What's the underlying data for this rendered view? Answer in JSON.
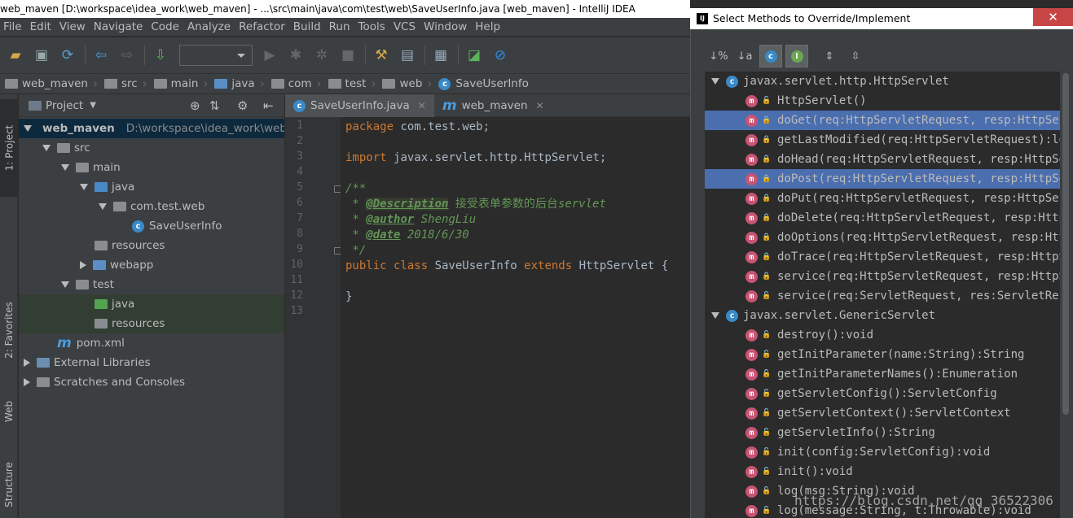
{
  "window": {
    "title": "web_maven [D:\\workspace\\idea_work\\web_maven] - ...\\src\\main\\java\\com\\test\\web\\SaveUserInfo.java [web_maven] - IntelliJ IDEA"
  },
  "menu": [
    "File",
    "Edit",
    "View",
    "Navigate",
    "Code",
    "Analyze",
    "Refactor",
    "Build",
    "Run",
    "Tools",
    "VCS",
    "Window",
    "Help"
  ],
  "breadcrumb": [
    "web_maven",
    "src",
    "main",
    "java",
    "com",
    "test",
    "web",
    "SaveUserInfo"
  ],
  "side_tabs": {
    "project": "1: Project",
    "favorites": "2: Favorites",
    "web": "Web",
    "structure": "Structure"
  },
  "project_panel": {
    "title": "Project",
    "tree": [
      {
        "label": "web_maven",
        "path": "D:\\workspace\\idea_work\\web_maven",
        "depth": 0,
        "arrow": "down",
        "icon": "module-folder-icon",
        "selected": true
      },
      {
        "label": "src",
        "depth": 1,
        "arrow": "down",
        "icon": "folder-icon"
      },
      {
        "label": "main",
        "depth": 2,
        "arrow": "down",
        "icon": "folder-icon"
      },
      {
        "label": "java",
        "depth": 3,
        "arrow": "down",
        "icon": "source-folder-icon"
      },
      {
        "label": "com.test.web",
        "depth": 4,
        "arrow": "down",
        "icon": "package-icon"
      },
      {
        "label": "SaveUserInfo",
        "depth": 5,
        "arrow": "",
        "icon": "class-icon"
      },
      {
        "label": "resources",
        "depth": 3,
        "arrow": "",
        "icon": "resources-folder-icon"
      },
      {
        "label": "webapp",
        "depth": 3,
        "arrow": "right",
        "icon": "web-folder-icon"
      },
      {
        "label": "test",
        "depth": 2,
        "arrow": "down",
        "icon": "folder-icon"
      },
      {
        "label": "java",
        "depth": 3,
        "arrow": "",
        "icon": "test-folder-icon",
        "highlight": true
      },
      {
        "label": "resources",
        "depth": 3,
        "arrow": "",
        "icon": "resources-folder-icon",
        "highlight": true
      },
      {
        "label": "pom.xml",
        "depth": 1,
        "arrow": "",
        "icon": "maven-icon"
      },
      {
        "label": "External Libraries",
        "depth": 0,
        "arrow": "right",
        "icon": "libraries-icon"
      },
      {
        "label": "Scratches and Consoles",
        "depth": 0,
        "arrow": "right",
        "icon": "scratches-icon"
      }
    ]
  },
  "editor": {
    "tabs": [
      {
        "label": "SaveUserInfo.java",
        "icon": "class-icon",
        "active": true,
        "close": "✕"
      },
      {
        "label": "web_maven",
        "icon": "maven-icon",
        "active": false,
        "close": "✕"
      }
    ],
    "line_numbers": [
      "1",
      "2",
      "3",
      "4",
      "5",
      "6",
      "7",
      "8",
      "9",
      "10",
      "11",
      "12",
      "13"
    ],
    "code": [
      [
        {
          "t": "package ",
          "c": "kw"
        },
        {
          "t": "com.test.web;",
          "c": "pl"
        }
      ],
      [],
      [
        {
          "t": "import ",
          "c": "kw"
        },
        {
          "t": "javax.servlet.http.HttpServlet;",
          "c": "pl"
        }
      ],
      [],
      [
        {
          "t": "/**",
          "c": "cm"
        }
      ],
      [
        {
          "t": " * ",
          "c": "cm"
        },
        {
          "t": "@Description",
          "c": "tag"
        },
        {
          "t": " 接受表单参数的后台",
          "c": "cn"
        },
        {
          "t": "servlet",
          "c": "cm"
        }
      ],
      [
        {
          "t": " * ",
          "c": "cm"
        },
        {
          "t": "@author",
          "c": "tag2"
        },
        {
          "t": " ShengLiu",
          "c": "cm"
        }
      ],
      [
        {
          "t": " * ",
          "c": "cm"
        },
        {
          "t": "@date",
          "c": "tag2"
        },
        {
          "t": " 2018/6/30",
          "c": "cm"
        }
      ],
      [
        {
          "t": " */",
          "c": "cm"
        }
      ],
      [
        {
          "t": "public class ",
          "c": "kw"
        },
        {
          "t": "SaveUserInfo ",
          "c": "pl"
        },
        {
          "t": "extends ",
          "c": "kw"
        },
        {
          "t": "HttpServlet {",
          "c": "pl"
        }
      ],
      [],
      [
        {
          "t": "}",
          "c": "pl"
        }
      ],
      []
    ]
  },
  "dialog": {
    "title": "Select Methods to Override/Implement",
    "close": "✕",
    "groups": [
      {
        "name": "javax.servlet.http.HttpServlet",
        "methods": [
          {
            "sig": "HttpServlet()",
            "vis": "public"
          },
          {
            "sig": "doGet(req:HttpServletRequest, resp:HttpServletResponse):void",
            "vis": "protected",
            "selected": true
          },
          {
            "sig": "getLastModified(req:HttpServletRequest):long",
            "vis": "protected"
          },
          {
            "sig": "doHead(req:HttpServletRequest, resp:HttpServletResponse):void",
            "vis": "protected"
          },
          {
            "sig": "doPost(req:HttpServletRequest, resp:HttpServletResponse):void",
            "vis": "protected",
            "selected": true
          },
          {
            "sig": "doPut(req:HttpServletRequest, resp:HttpServletResponse):void",
            "vis": "protected"
          },
          {
            "sig": "doDelete(req:HttpServletRequest, resp:HttpServletResponse):void",
            "vis": "protected"
          },
          {
            "sig": "doOptions(req:HttpServletRequest, resp:HttpServletResponse):void",
            "vis": "protected"
          },
          {
            "sig": "doTrace(req:HttpServletRequest, resp:HttpServletResponse):void",
            "vis": "protected"
          },
          {
            "sig": "service(req:HttpServletRequest, resp:HttpServletResponse):void",
            "vis": "protected"
          },
          {
            "sig": "service(req:ServletRequest, res:ServletResponse):void",
            "vis": "public"
          }
        ]
      },
      {
        "name": "javax.servlet.GenericServlet",
        "methods": [
          {
            "sig": "destroy():void",
            "vis": "public"
          },
          {
            "sig": "getInitParameter(name:String):String",
            "vis": "public"
          },
          {
            "sig": "getInitParameterNames():Enumeration",
            "vis": "public"
          },
          {
            "sig": "getServletConfig():ServletConfig",
            "vis": "public"
          },
          {
            "sig": "getServletContext():ServletContext",
            "vis": "public"
          },
          {
            "sig": "getServletInfo():String",
            "vis": "public"
          },
          {
            "sig": "init(config:ServletConfig):void",
            "vis": "public"
          },
          {
            "sig": "init():void",
            "vis": "public"
          },
          {
            "sig": "log(msg:String):void",
            "vis": "public"
          },
          {
            "sig": "log(message:String, t:Throwable):void",
            "vis": "public"
          }
        ]
      }
    ]
  },
  "watermark": "https://blog.csdn.net/qq_36522306"
}
